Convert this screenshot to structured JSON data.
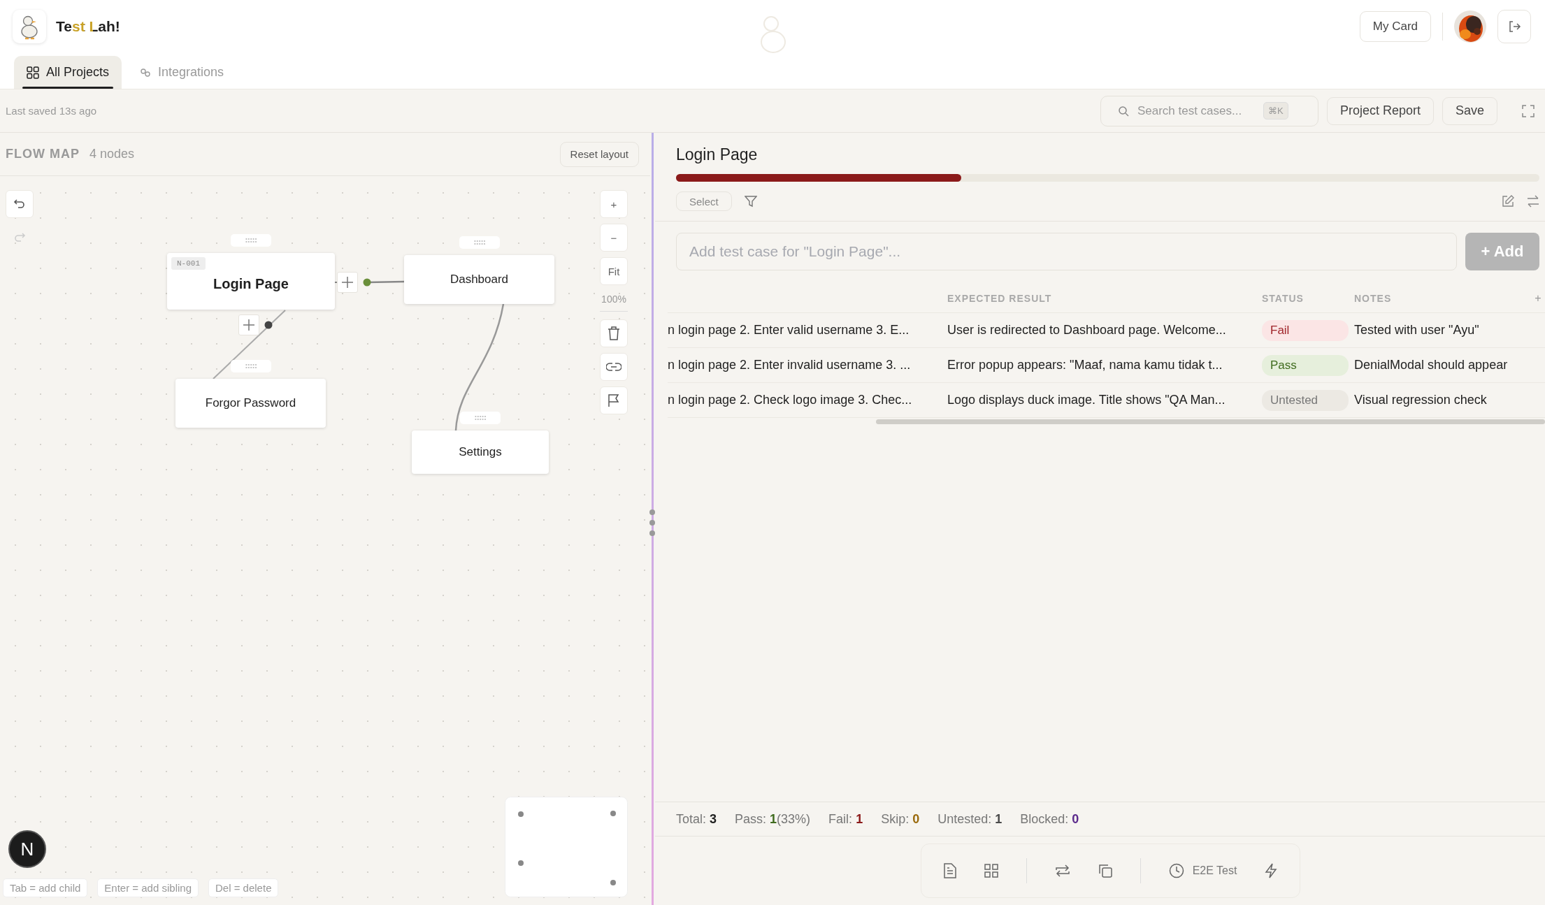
{
  "app": {
    "title": "Test Lah!",
    "my_card": "My Card"
  },
  "tabs": [
    {
      "label": "All Projects",
      "selected": true,
      "kind": "grid"
    },
    {
      "label": "Integrations",
      "selected": false,
      "kind": "link"
    }
  ],
  "toolbar": {
    "last_saved": "Last saved 13s ago",
    "search": {
      "placeholder": "Search test cases...",
      "shortcut": "⌘K"
    },
    "buttons": [
      "Project Report",
      "Save"
    ]
  },
  "flow_map": {
    "title": "FLOW MAP",
    "count": "4 nodes",
    "reset": "Reset layout",
    "zoom_buttons": [
      "+",
      "−",
      "Fit"
    ],
    "zoom": "100%",
    "nodes": [
      {
        "tag": "N-001",
        "name": "Login Page",
        "selected": true
      },
      {
        "name": "Dashboard",
        "selected": false
      },
      {
        "name": "Forgor Password",
        "selected": false
      },
      {
        "name": "Settings",
        "selected": false
      }
    ],
    "hints": [
      "Tab = add child",
      "Enter = add sibling",
      "Del = delete"
    ]
  },
  "dev_badge": "N",
  "panel": {
    "title": "Login Page",
    "level": 0.33,
    "select": "Select",
    "add_placeholder": "Add test case for \"Login Page\"...",
    "add_button": "+ Add",
    "columns": [
      "EXPECTED RESULT",
      "STATUS",
      "NOTES"
    ],
    "add_column": "+",
    "rows": [
      {
        "steps": "n login page 2. Enter valid username 3. E...",
        "expected": "User is redirected to Dashboard page. Welcome...",
        "status": "Fail",
        "kind": "fail",
        "notes": "Tested with user \"Ayu\""
      },
      {
        "steps": "n login page 2. Enter invalid username 3. ...",
        "expected": "Error popup appears: \"Maaf, nama kamu tidak t...",
        "status": "Pass",
        "kind": "pass",
        "notes": "DenialModal should appear"
      },
      {
        "steps": "n login page 2. Check logo image 3. Chec...",
        "expected": "Logo displays duck image. Title shows \"QA Man...",
        "status": "Untested",
        "kind": "untested",
        "notes": "Visual regression check"
      }
    ],
    "stats": [
      {
        "label": "Total:",
        "value": "3",
        "color": "#1f1f1f"
      },
      {
        "label": "Pass:",
        "value": "1",
        "extra": "(33%)",
        "color": "#3f6b1e"
      },
      {
        "label": "Fail:",
        "value": "1",
        "color": "#8b1a1a"
      },
      {
        "label": "Skip:",
        "value": "0",
        "color": "#9a6a0c"
      },
      {
        "label": "Untested:",
        "value": "1",
        "color": "#4a4a4a"
      },
      {
        "label": "Blocked:",
        "value": "0",
        "color": "#5b2a8c"
      }
    ],
    "footer_tool": "E2E Test"
  }
}
